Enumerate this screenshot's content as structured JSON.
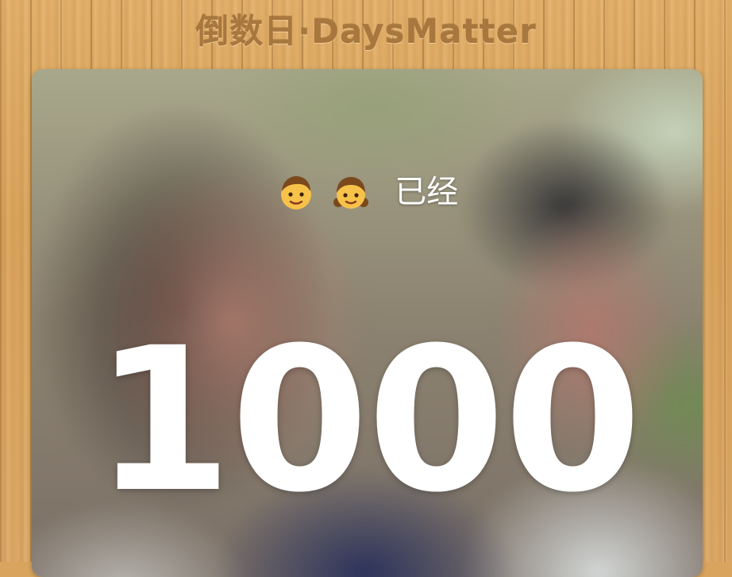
{
  "header": {
    "title": "倒数日·DaysMatter"
  },
  "event": {
    "icons": [
      "boy-emoji-icon",
      "girl-emoji-icon"
    ],
    "label": "已经",
    "days": "1000"
  },
  "colors": {
    "wood": "#d9a35b",
    "title_text": "#a8773e",
    "count_text": "#ffffff"
  }
}
